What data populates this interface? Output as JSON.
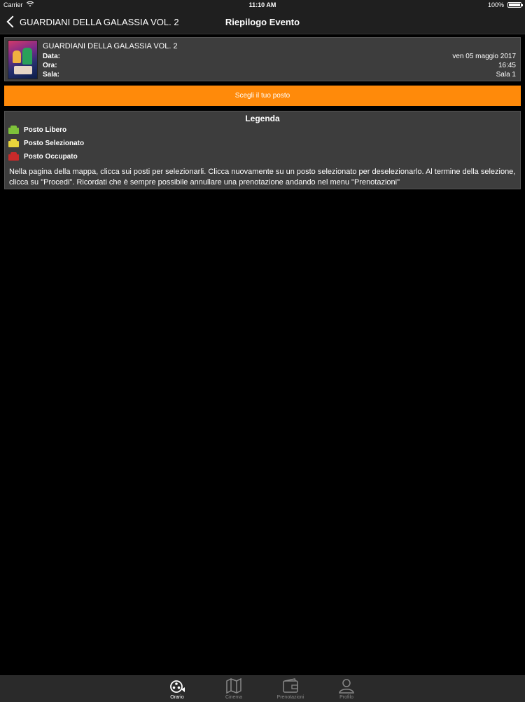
{
  "status": {
    "carrier": "Carrier",
    "time": "11:10 AM",
    "battery": "100%"
  },
  "nav": {
    "back_label": "GUARDIANI DELLA GALASSIA VOL. 2",
    "title": "Riepilogo Evento"
  },
  "event": {
    "title": "GUARDIANI DELLA GALASSIA VOL. 2",
    "rows": [
      {
        "label": "Data:",
        "value": "ven 05 maggio 2017"
      },
      {
        "label": "Ora:",
        "value": "16:45"
      },
      {
        "label": "Sala:",
        "value": "Sala 1"
      }
    ]
  },
  "choose_button": "Scegli il tuo posto",
  "legend": {
    "title": "Legenda",
    "items": [
      {
        "label": "Posto Libero",
        "color": "#7ec23a"
      },
      {
        "label": "Posto Selezionato",
        "color": "#e8d43c"
      },
      {
        "label": "Posto Occupato",
        "color": "#c82a2a"
      }
    ],
    "description": "Nella pagina della mappa, clicca sui posti per selezionarli. Clicca nuovamente su un posto selezionato per deselezionarlo. Al termine della selezione, clicca su \"Procedi\". Ricordati che è sempre possibile annullare una prenotazione andando nel menu \"Prenotazioni\""
  },
  "tabs": [
    {
      "label": "Orario",
      "icon": "film-reel-icon",
      "active": true
    },
    {
      "label": "Cinema",
      "icon": "map-icon",
      "active": false
    },
    {
      "label": "Prenotazioni",
      "icon": "wallet-icon",
      "active": false
    },
    {
      "label": "Profilo",
      "icon": "person-icon",
      "active": false
    }
  ]
}
